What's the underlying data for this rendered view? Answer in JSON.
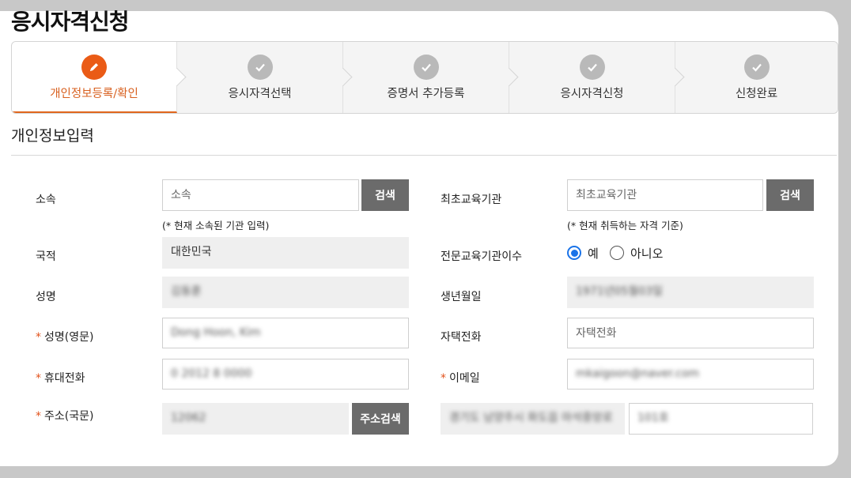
{
  "page": {
    "title": "응시자격신청"
  },
  "stepper": {
    "steps": [
      {
        "label": "개인정보등록/확인",
        "state": "active",
        "icon": "pencil-icon"
      },
      {
        "label": "응시자격선택",
        "state": "pending",
        "icon": "check-icon"
      },
      {
        "label": "증명서 추가등록",
        "state": "pending",
        "icon": "check-icon"
      },
      {
        "label": "응시자격신청",
        "state": "pending",
        "icon": "check-icon"
      },
      {
        "label": "신청완료",
        "state": "pending",
        "icon": "check-icon"
      }
    ]
  },
  "section": {
    "title": "개인정보입력"
  },
  "form": {
    "affiliation": {
      "label": "소속",
      "placeholder": "소속",
      "search_label": "검색",
      "hint": "(* 현재 소속된 기관 입력)"
    },
    "first_institution": {
      "label": "최초교육기관",
      "placeholder": "최초교육기관",
      "search_label": "검색",
      "hint": "(* 현재 취득하는 자격 기준)"
    },
    "nationality": {
      "label": "국적",
      "value": "대한민국"
    },
    "completed_institution": {
      "label": "전문교육기관이수",
      "options": [
        "예",
        "아니오"
      ],
      "selected": "예"
    },
    "name": {
      "label": "성명",
      "value": "김동훈"
    },
    "birthdate": {
      "label": "생년월일",
      "value": "1971년05월03일"
    },
    "name_en": {
      "required": "*",
      "label": "성명(영문)",
      "value": "Dong Hoon, Kim"
    },
    "home_phone": {
      "label": "자택전화",
      "placeholder": "자택전화"
    },
    "mobile": {
      "required": "*",
      "label": "휴대전화",
      "value": "0 2012 8 0000"
    },
    "email": {
      "required": "*",
      "label": "이메일",
      "value": "mkaigoon@naver.com"
    },
    "address": {
      "required": "*",
      "label": "주소(국문)",
      "zip": "12062",
      "search_label": "주소검색",
      "road": "경기도 남양주시 화도읍 마석중앙로",
      "detail": "101호"
    }
  },
  "colors": {
    "accent": "#ea5b16",
    "button": "#6b6b6b",
    "radio": "#1a73e8"
  }
}
